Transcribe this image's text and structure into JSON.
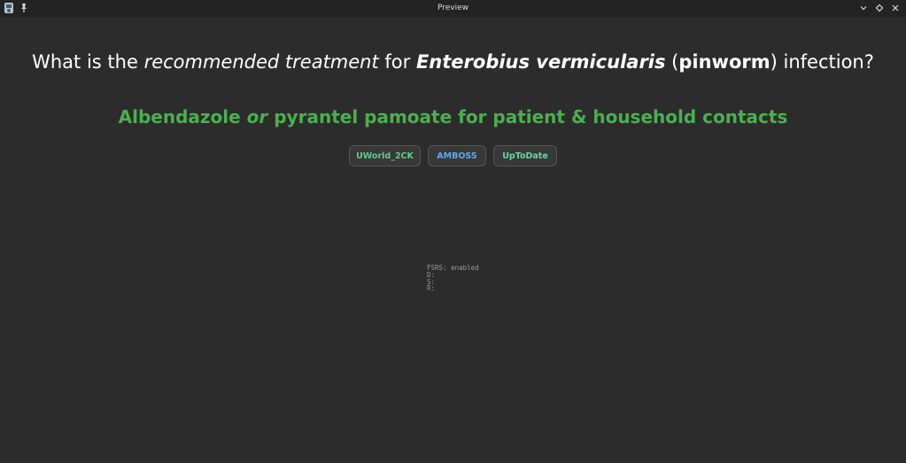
{
  "window": {
    "title": "Preview",
    "controls": [
      "chevron-down",
      "diamond",
      "close"
    ]
  },
  "card": {
    "question": {
      "p1": "What is the ",
      "p2": "recommended treatment",
      "p3": " for ",
      "p4": "Enterobius vermicularis",
      "p5": " (",
      "p6": "pinworm",
      "p7": ") infection?"
    },
    "answer": {
      "p1": "Albendazole ",
      "p2": "or",
      "p3": " pyrantel pamoate for patient & household contacts"
    },
    "sources": [
      "UWorld_2CK",
      "AMBOSS",
      "UpToDate"
    ]
  },
  "fsrs": {
    "status": "FSRS: enabled",
    "d": "D:",
    "s": "S:",
    "r": "R:"
  },
  "colors": {
    "background": "#2c2c2c",
    "titlebar": "#232323",
    "answer": "#4caf50",
    "uworld": "#67c987",
    "amboss": "#64a7e8",
    "uptodate": "#6fd3a7"
  }
}
